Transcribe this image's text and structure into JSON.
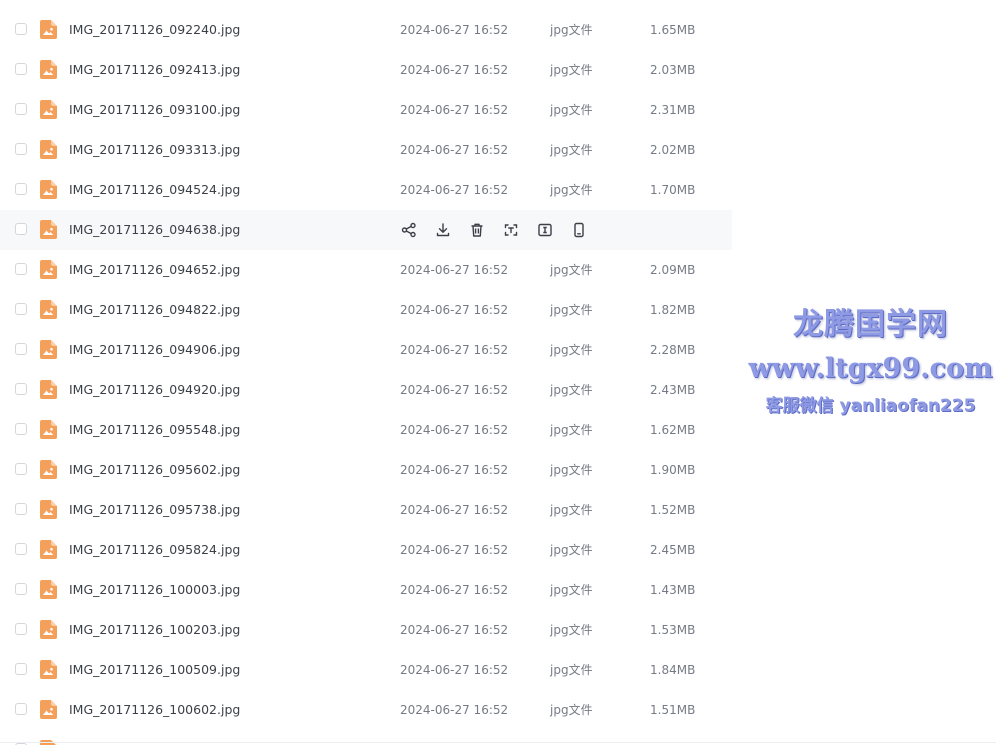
{
  "files": [
    {
      "name": "IMG_20171126_092240.jpg",
      "date": "2024-06-27 16:52",
      "type": "jpg文件",
      "size": "1.65MB"
    },
    {
      "name": "IMG_20171126_092413.jpg",
      "date": "2024-06-27 16:52",
      "type": "jpg文件",
      "size": "2.03MB"
    },
    {
      "name": "IMG_20171126_093100.jpg",
      "date": "2024-06-27 16:52",
      "type": "jpg文件",
      "size": "2.31MB"
    },
    {
      "name": "IMG_20171126_093313.jpg",
      "date": "2024-06-27 16:52",
      "type": "jpg文件",
      "size": "2.02MB"
    },
    {
      "name": "IMG_20171126_094524.jpg",
      "date": "2024-06-27 16:52",
      "type": "jpg文件",
      "size": "1.70MB"
    },
    {
      "name": "IMG_20171126_094638.jpg",
      "hovered": true
    },
    {
      "name": "IMG_20171126_094652.jpg",
      "date": "2024-06-27 16:52",
      "type": "jpg文件",
      "size": "2.09MB"
    },
    {
      "name": "IMG_20171126_094822.jpg",
      "date": "2024-06-27 16:52",
      "type": "jpg文件",
      "size": "1.82MB"
    },
    {
      "name": "IMG_20171126_094906.jpg",
      "date": "2024-06-27 16:52",
      "type": "jpg文件",
      "size": "2.28MB"
    },
    {
      "name": "IMG_20171126_094920.jpg",
      "date": "2024-06-27 16:52",
      "type": "jpg文件",
      "size": "2.43MB"
    },
    {
      "name": "IMG_20171126_095548.jpg",
      "date": "2024-06-27 16:52",
      "type": "jpg文件",
      "size": "1.62MB"
    },
    {
      "name": "IMG_20171126_095602.jpg",
      "date": "2024-06-27 16:52",
      "type": "jpg文件",
      "size": "1.90MB"
    },
    {
      "name": "IMG_20171126_095738.jpg",
      "date": "2024-06-27 16:52",
      "type": "jpg文件",
      "size": "1.52MB"
    },
    {
      "name": "IMG_20171126_095824.jpg",
      "date": "2024-06-27 16:52",
      "type": "jpg文件",
      "size": "2.45MB"
    },
    {
      "name": "IMG_20171126_100003.jpg",
      "date": "2024-06-27 16:52",
      "type": "jpg文件",
      "size": "1.43MB"
    },
    {
      "name": "IMG_20171126_100203.jpg",
      "date": "2024-06-27 16:52",
      "type": "jpg文件",
      "size": "1.53MB"
    },
    {
      "name": "IMG_20171126_100509.jpg",
      "date": "2024-06-27 16:52",
      "type": "jpg文件",
      "size": "1.84MB"
    },
    {
      "name": "IMG_20171126_100602.jpg",
      "date": "2024-06-27 16:52",
      "type": "jpg文件",
      "size": "1.51MB"
    }
  ],
  "hover_actions": [
    "share-icon",
    "download-icon",
    "delete-icon",
    "scan-icon",
    "rename-icon",
    "mobile-icon"
  ],
  "watermark": {
    "title": "龙腾国学网",
    "url": "www.ltgx99.com",
    "contact": "客服微信 yanliaofan225"
  },
  "colors": {
    "file_icon": "#f5a05a",
    "file_icon_fold": "#fbd0a7",
    "hover_row": "#f7f8fa",
    "watermark": "#8e9ae4"
  }
}
